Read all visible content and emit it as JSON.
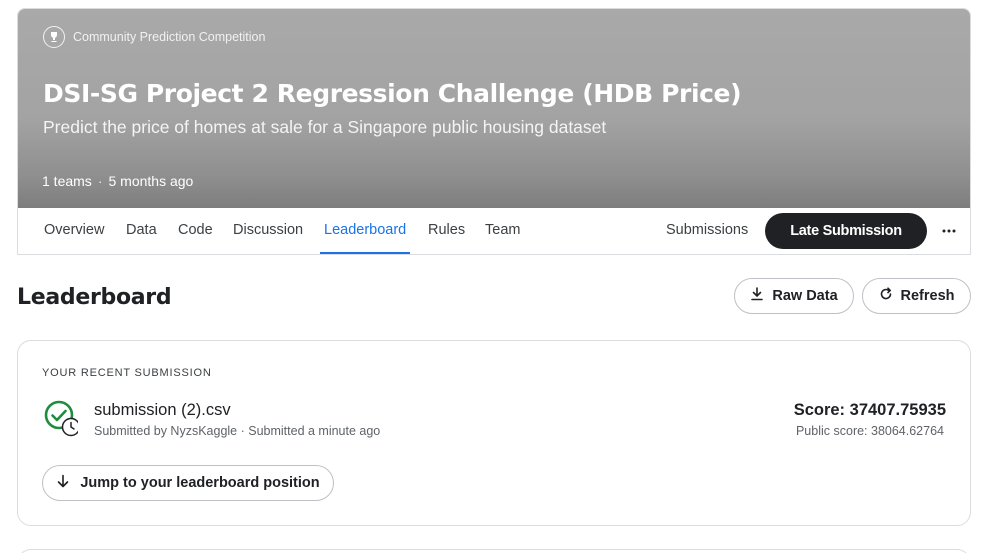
{
  "competition": {
    "type_label": "Community Prediction Competition",
    "title": "DSI-SG Project 2 Regression Challenge (HDB Price)",
    "subtitle": "Predict the price of homes at sale for a Singapore public housing dataset",
    "teams": "1 teams",
    "separator": "·",
    "age": "5 months ago"
  },
  "tabs": [
    {
      "label": "Overview"
    },
    {
      "label": "Data"
    },
    {
      "label": "Code"
    },
    {
      "label": "Discussion"
    },
    {
      "label": "Leaderboard",
      "active": true
    },
    {
      "label": "Rules"
    },
    {
      "label": "Team"
    }
  ],
  "actions": {
    "submissions_label": "Submissions",
    "late_submission_label": "Late Submission",
    "more_icon": "more-horizontal-icon"
  },
  "leaderboard": {
    "title": "Leaderboard",
    "raw_data_label": "Raw Data",
    "refresh_label": "Refresh"
  },
  "recent_submission": {
    "section_label": "YOUR RECENT SUBMISSION",
    "file_name": "submission (2).csv",
    "submitted_by": "Submitted by NyzsKaggle · Submitted a minute ago",
    "score": "Score: 37407.75935",
    "public_score": "Public score: 38064.62764",
    "jump_label": "Jump to your leaderboard position"
  },
  "colors": {
    "accent": "#1a73e8",
    "success": "#1e8e3e",
    "dark_button": "#202124"
  }
}
